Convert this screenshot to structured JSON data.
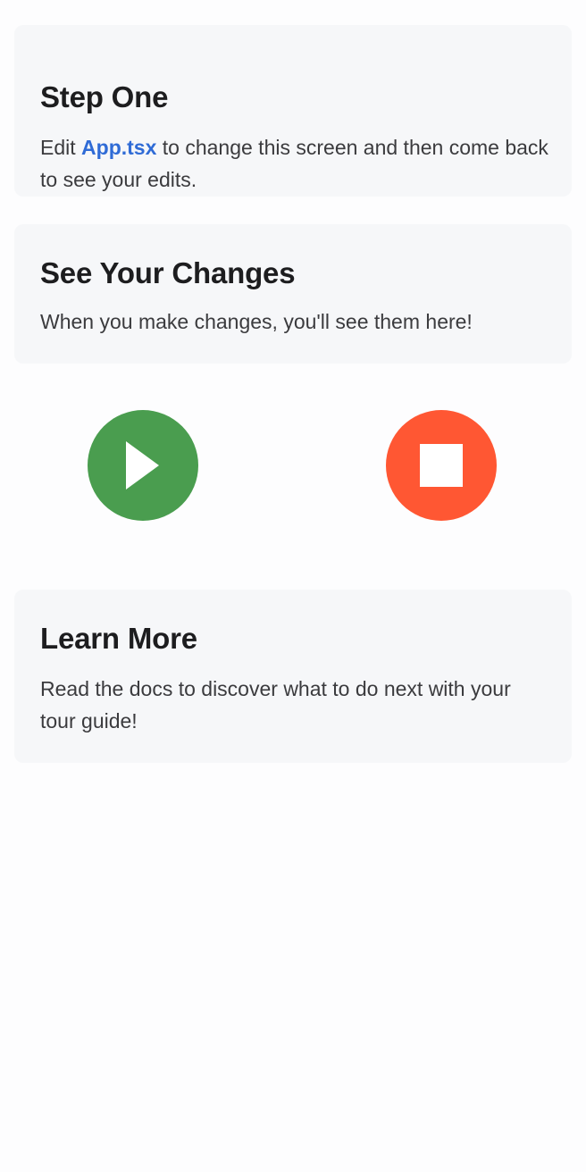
{
  "step_one": {
    "title": "Step One",
    "text_before": "Edit ",
    "link": "App.tsx",
    "text_after": " to change this screen and then come back to see your edits."
  },
  "see_changes": {
    "title": "See Your Changes",
    "text": "When you make changes, you'll see them here!"
  },
  "controls": {
    "play_icon": "play-icon",
    "stop_icon": "stop-icon",
    "play_color": "#4a9d4f",
    "stop_color": "#ff5733"
  },
  "learn_more": {
    "title": "Learn More",
    "text": "Read the docs to discover what to do next with your tour guide!"
  },
  "colors": {
    "background": "#fdfdfe",
    "card": "#f6f7f9",
    "link": "#2f6bd6"
  }
}
